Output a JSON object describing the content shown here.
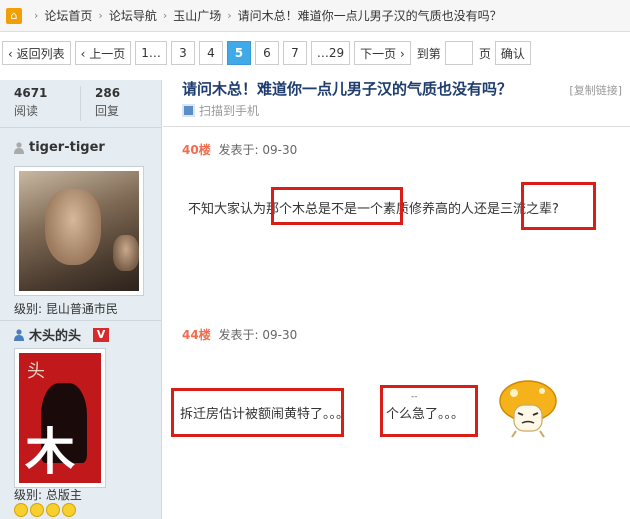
{
  "breadcrumb": {
    "items": [
      "论坛首页",
      "论坛导航",
      "玉山广场",
      "请问木总！难道你一点儿男子汉的气质也没有吗？"
    ]
  },
  "pager": {
    "back": "‹ 返回列表",
    "prev": "‹ 上一页",
    "pages": [
      "1…",
      "3",
      "4",
      "5",
      "6",
      "7",
      "…29"
    ],
    "current": "5",
    "next": "下一页 ›",
    "goto_prefix": "到第",
    "goto_suffix": "页",
    "confirm": "确认"
  },
  "stats": {
    "views": "4671",
    "views_label": "阅读",
    "replies": "286",
    "replies_label": "回复"
  },
  "thread": {
    "title": "请问木总！难道你一点儿男子汉的气质也没有吗？",
    "copy_link": "[复制链接]",
    "scan_to_phone": "扫描到手机"
  },
  "posts": [
    {
      "author": "tiger-tiger",
      "level": "级别: 昆山普通市民",
      "floor": "40楼",
      "posted": "发表于: 09-30",
      "message": "不知大家认为那个木总是不是一个素质修养高的人还是三流之辈?"
    },
    {
      "author": "木头的头",
      "badge": "V",
      "level": "级别: 总版主",
      "floor": "44楼",
      "posted": "发表于: 09-30",
      "message_1": "拆迁房估计被额闹黄特了。。。",
      "message_2": "个么急了。。。",
      "annotation": "--"
    }
  ],
  "colors": {
    "accent": "#40a9e8",
    "highlight_box": "#d91e18",
    "floor_number": "#f26c4f",
    "title": "#1e3c6e"
  }
}
